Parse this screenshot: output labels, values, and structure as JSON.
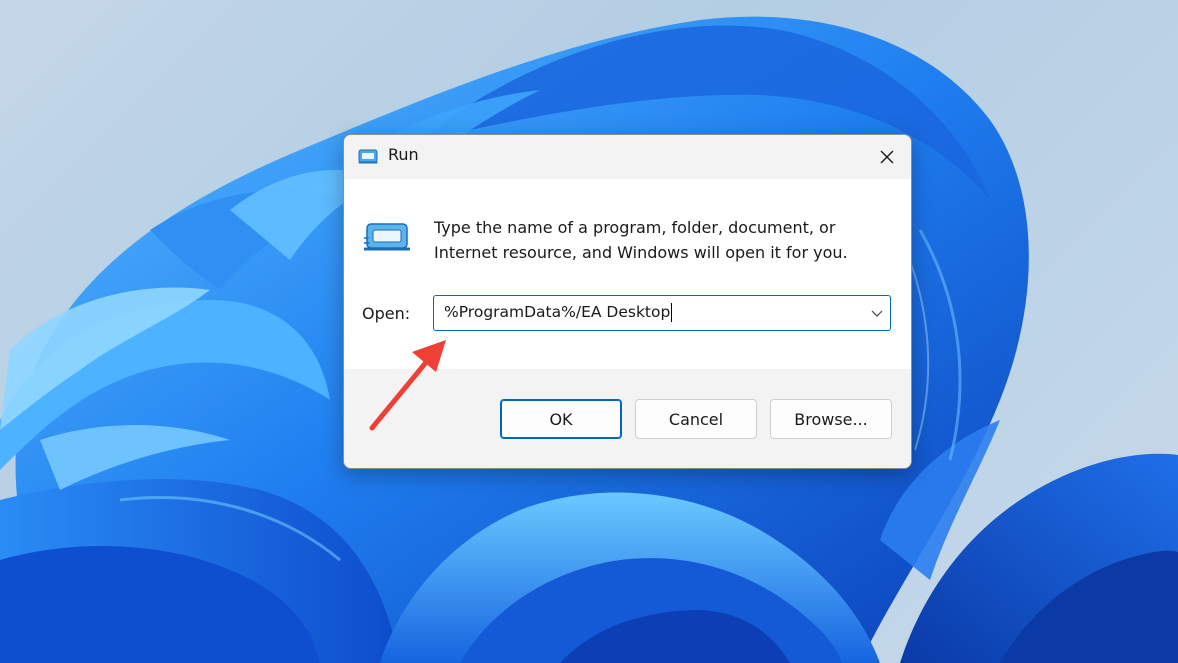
{
  "window": {
    "title": "Run"
  },
  "dialog": {
    "description": "Type the name of a program, folder, document, or Internet resource, and Windows will open it for you.",
    "open_label": "Open:",
    "open_value": "%ProgramData%/EA Desktop"
  },
  "buttons": {
    "ok": "OK",
    "cancel": "Cancel",
    "browse": "Browse..."
  },
  "icons": {
    "title": "run-icon",
    "body": "run-icon",
    "close": "close-icon",
    "dropdown": "chevron-down-icon",
    "annotation": "red-arrow-annotation"
  },
  "colors": {
    "accent": "#0067c0",
    "annotation": "#ef4035",
    "wallpaper_blue": "#1a6ee8"
  }
}
